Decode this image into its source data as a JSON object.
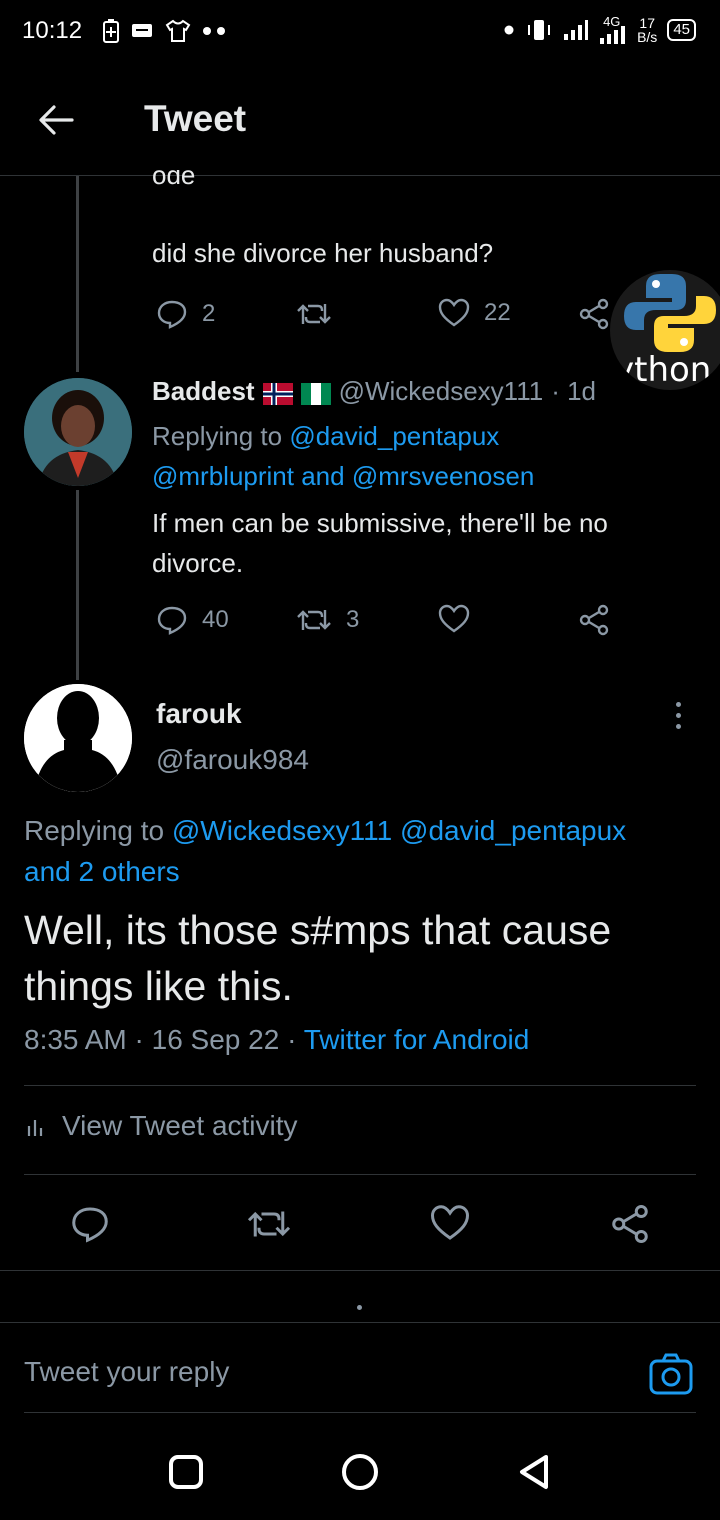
{
  "status_bar": {
    "time": "10:12",
    "network": "4G",
    "speed_value": "17",
    "speed_unit": "B/s",
    "battery": "45"
  },
  "header": {
    "title": "Tweet"
  },
  "tweet_top": {
    "cut_text": "ode",
    "text": "did she divorce her husband?",
    "replies": "2",
    "retweets": "",
    "likes": "22"
  },
  "overlay": {
    "python_text": "ython"
  },
  "tweet_reply": {
    "name": "Baddest",
    "handle": "@Wickedsexy111",
    "time": "· 1d",
    "replying_label": "Replying to",
    "replying_mention_1": "@david_pentapux",
    "replying_mention_2": "@mrbluprint",
    "replying_and": "and",
    "replying_mention_3": "@mrsveenosen",
    "text": "If men can be submissive, there'll be no divorce.",
    "replies": "40",
    "retweets": "3",
    "likes": ""
  },
  "main_tweet": {
    "name": "farouk",
    "handle": "@farouk984",
    "replying_label": "Replying to",
    "replying_mention_1": "@Wickedsexy111",
    "replying_mention_2": "@david_pentapux",
    "replying_others": "and 2 others",
    "text": "Well, its those s#mps that cause things like this.",
    "time": "8:35 AM",
    "date": "16 Sep 22",
    "source": "Twitter for Android",
    "activity_label": "View Tweet activity"
  },
  "reply_box": {
    "placeholder": "Tweet your reply"
  },
  "colors": {
    "accent": "#1d9bf0",
    "background": "#000000",
    "muted": "#8b98a5"
  }
}
